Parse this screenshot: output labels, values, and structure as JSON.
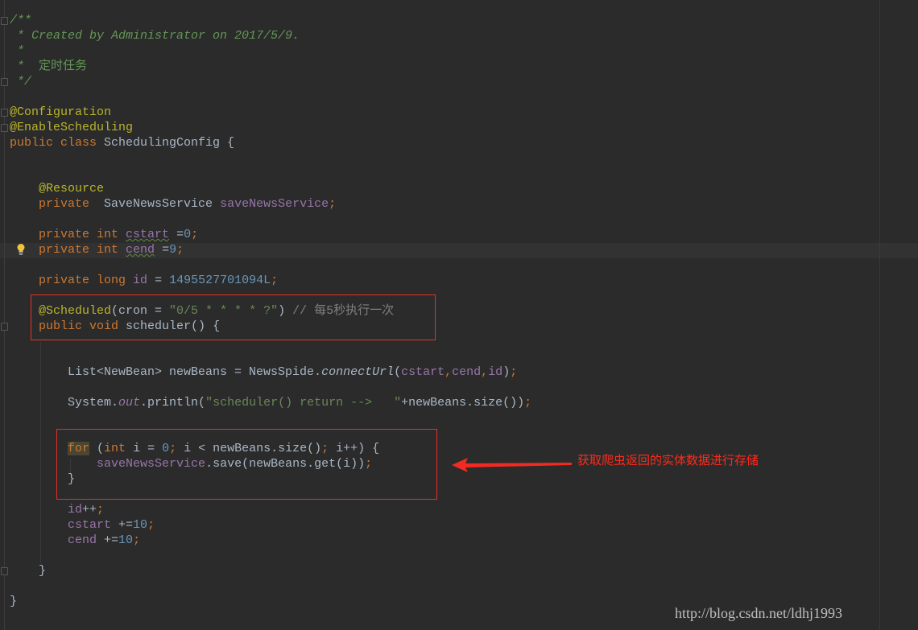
{
  "editor": {
    "theme_colors": {
      "background": "#2b2b2b",
      "keyword": "#cc7832",
      "annotation": "#bbb529",
      "doc_comment": "#629755",
      "field": "#9876aa",
      "number": "#6897bb",
      "string": "#6a8759",
      "line_comment": "#808080",
      "text": "#a9b7c6",
      "highlight_box": "#e8302a"
    },
    "lines": [
      [
        [
          "doc",
          "/**"
        ]
      ],
      [
        [
          "doc",
          " * Created by Administrator on 2017/5/9."
        ]
      ],
      [
        [
          "doc",
          " *"
        ]
      ],
      [
        [
          "doc",
          " *  "
        ],
        [
          "docz",
          "定时任务"
        ]
      ],
      [
        [
          "doc",
          " */"
        ]
      ],
      [],
      [
        [
          "an",
          "@Configuration"
        ]
      ],
      [
        [
          "an",
          "@EnableScheduling"
        ]
      ],
      [
        [
          "kw",
          "public class "
        ],
        [
          "def",
          "SchedulingConfig {"
        ]
      ],
      [],
      [],
      [
        [
          "def",
          "    "
        ],
        [
          "an",
          "@Resource"
        ]
      ],
      [
        [
          "def",
          "    "
        ],
        [
          "kw",
          "private  "
        ],
        [
          "def",
          "SaveNewsService "
        ],
        [
          "fld",
          "saveNewsService"
        ],
        [
          "kw",
          ";"
        ]
      ],
      [],
      [
        [
          "def",
          "    "
        ],
        [
          "kw",
          "private int "
        ],
        [
          "fld warn",
          "cstart"
        ],
        [
          "def",
          " ="
        ],
        [
          "num",
          "0"
        ],
        [
          "kw",
          ";"
        ]
      ],
      [
        [
          "def",
          "    "
        ],
        [
          "kw",
          "private int "
        ],
        [
          "fld warn",
          "cend"
        ],
        [
          "def",
          " ="
        ],
        [
          "num",
          "9"
        ],
        [
          "kw",
          ";"
        ]
      ],
      [],
      [
        [
          "def",
          "    "
        ],
        [
          "kw",
          "private long "
        ],
        [
          "fld",
          "id"
        ],
        [
          "def",
          " = "
        ],
        [
          "num",
          "1495527701094L"
        ],
        [
          "kw",
          ";"
        ]
      ],
      [],
      [
        [
          "def",
          "    "
        ],
        [
          "an",
          "@Scheduled"
        ],
        [
          "def",
          "(cron = "
        ],
        [
          "str",
          "\"0/5 * * * * ?\""
        ],
        [
          "def",
          ") "
        ],
        [
          "cmt",
          "// 每5秒执行一次"
        ]
      ],
      [
        [
          "def",
          "    "
        ],
        [
          "kw",
          "public void "
        ],
        [
          "def",
          "scheduler() {"
        ]
      ],
      [],
      [],
      [
        [
          "def",
          "        List<NewBean> newBeans = NewsSpide."
        ],
        [
          "def it",
          "connectUrl"
        ],
        [
          "def",
          "("
        ],
        [
          "fld",
          "cstart"
        ],
        [
          "kw",
          ","
        ],
        [
          "fld",
          "cend"
        ],
        [
          "kw",
          ","
        ],
        [
          "fld",
          "id"
        ],
        [
          "def",
          ")"
        ],
        [
          "kw",
          ";"
        ]
      ],
      [],
      [
        [
          "def",
          "        System."
        ],
        [
          "fit",
          "out"
        ],
        [
          "def",
          ".println("
        ],
        [
          "str",
          "\"scheduler() return -->   \""
        ],
        [
          "def",
          "+newBeans.size())"
        ],
        [
          "kw",
          ";"
        ]
      ],
      [],
      [],
      [
        [
          "def",
          "        "
        ],
        [
          "kw forhl",
          "for"
        ],
        [
          "def",
          " ("
        ],
        [
          "kw",
          "int "
        ],
        [
          "def",
          "i = "
        ],
        [
          "num",
          "0"
        ],
        [
          "kw",
          "; "
        ],
        [
          "def",
          "i < newBeans.size()"
        ],
        [
          "kw",
          "; "
        ],
        [
          "def",
          "i++) {"
        ]
      ],
      [
        [
          "def",
          "            "
        ],
        [
          "fld",
          "saveNewsService"
        ],
        [
          "def",
          ".save(newBeans.get(i))"
        ],
        [
          "kw",
          ";"
        ]
      ],
      [
        [
          "def",
          "        }"
        ]
      ],
      [],
      [
        [
          "def",
          "        "
        ],
        [
          "fld",
          "id"
        ],
        [
          "def",
          "++"
        ],
        [
          "kw",
          ";"
        ]
      ],
      [
        [
          "def",
          "        "
        ],
        [
          "fld",
          "cstart"
        ],
        [
          "def",
          " +="
        ],
        [
          "num",
          "10"
        ],
        [
          "kw",
          ";"
        ]
      ],
      [
        [
          "def",
          "        "
        ],
        [
          "fld",
          "cend"
        ],
        [
          "def",
          " +="
        ],
        [
          "num",
          "10"
        ],
        [
          "kw",
          ";"
        ]
      ],
      [],
      [
        [
          "def",
          "    }"
        ]
      ],
      [],
      [
        [
          "def",
          "}"
        ]
      ]
    ]
  },
  "annotation": {
    "text": "获取爬虫返回的实体数据进行存储",
    "color": "#ff2a1a"
  },
  "watermark": "http://blog.csdn.net/ldhj1993",
  "icons": {
    "bulb": "intention-bulb-icon",
    "fold": "fold-marker-icon"
  }
}
